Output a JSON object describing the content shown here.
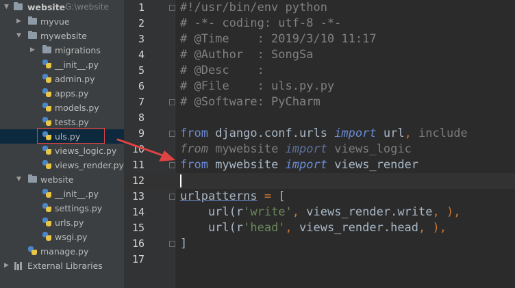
{
  "project_tree": {
    "root_name": "website",
    "root_path": "G:\\website",
    "items": [
      {
        "label": "myvue"
      },
      {
        "label": "mywebsite"
      },
      {
        "label": "migrations"
      },
      {
        "label": "__init__.py"
      },
      {
        "label": "admin.py"
      },
      {
        "label": "apps.py"
      },
      {
        "label": "models.py"
      },
      {
        "label": "tests.py"
      },
      {
        "label": "uls.py"
      },
      {
        "label": "views_logic.py"
      },
      {
        "label": "views_render.py"
      },
      {
        "label": "website"
      },
      {
        "label": "__init__.py"
      },
      {
        "label": "settings.py"
      },
      {
        "label": "urls.py"
      },
      {
        "label": "wsgi.py"
      },
      {
        "label": "manage.py"
      },
      {
        "label": "External Libraries"
      }
    ]
  },
  "editor": {
    "line_numbers": [
      "1",
      "2",
      "3",
      "4",
      "5",
      "6",
      "7",
      "8",
      "9",
      "10",
      "11",
      "12",
      "13",
      "14",
      "15",
      "16",
      "17"
    ],
    "code": {
      "l1": "#!/usr/bin/env python",
      "l2": "# -*- coding: utf-8 -*-",
      "l3": "# @Time    : 2019/3/10 11:17",
      "l4": "# @Author  : SongSa",
      "l5": "# @Desc    :",
      "l6": "# @File    : uls.py.py",
      "l7": "# @Software: PyCharm",
      "l9_from": "from",
      "l9_mod": " django.conf.urls ",
      "l9_import": "import",
      "l9_name": " url",
      "l9_comma": ",",
      "l9_include": " include",
      "l10_from": "from",
      "l10_mod": " mywebsite ",
      "l10_import": "import",
      "l10_name": " views_logic",
      "l11_from": "from",
      "l11_mod": " mywebsite ",
      "l11_import": "import",
      "l11_name": " views_render",
      "l13_var": "urlpatterns",
      "l13_eq": " = ",
      "l13_br": "[",
      "l14_call": "    url(r",
      "l14_str": "'write'",
      "l14_comma1": ",",
      "l14_rest": " views_render.write",
      "l14_comma2": ",",
      "l14_close": " ),",
      "l15_call": "    url(r",
      "l15_str": "'head'",
      "l15_comma1": ",",
      "l15_rest": " views_render.head",
      "l15_comma2": ",",
      "l15_close": " ),",
      "l16": "]"
    }
  },
  "colors": {
    "annotation": "#e04343"
  }
}
